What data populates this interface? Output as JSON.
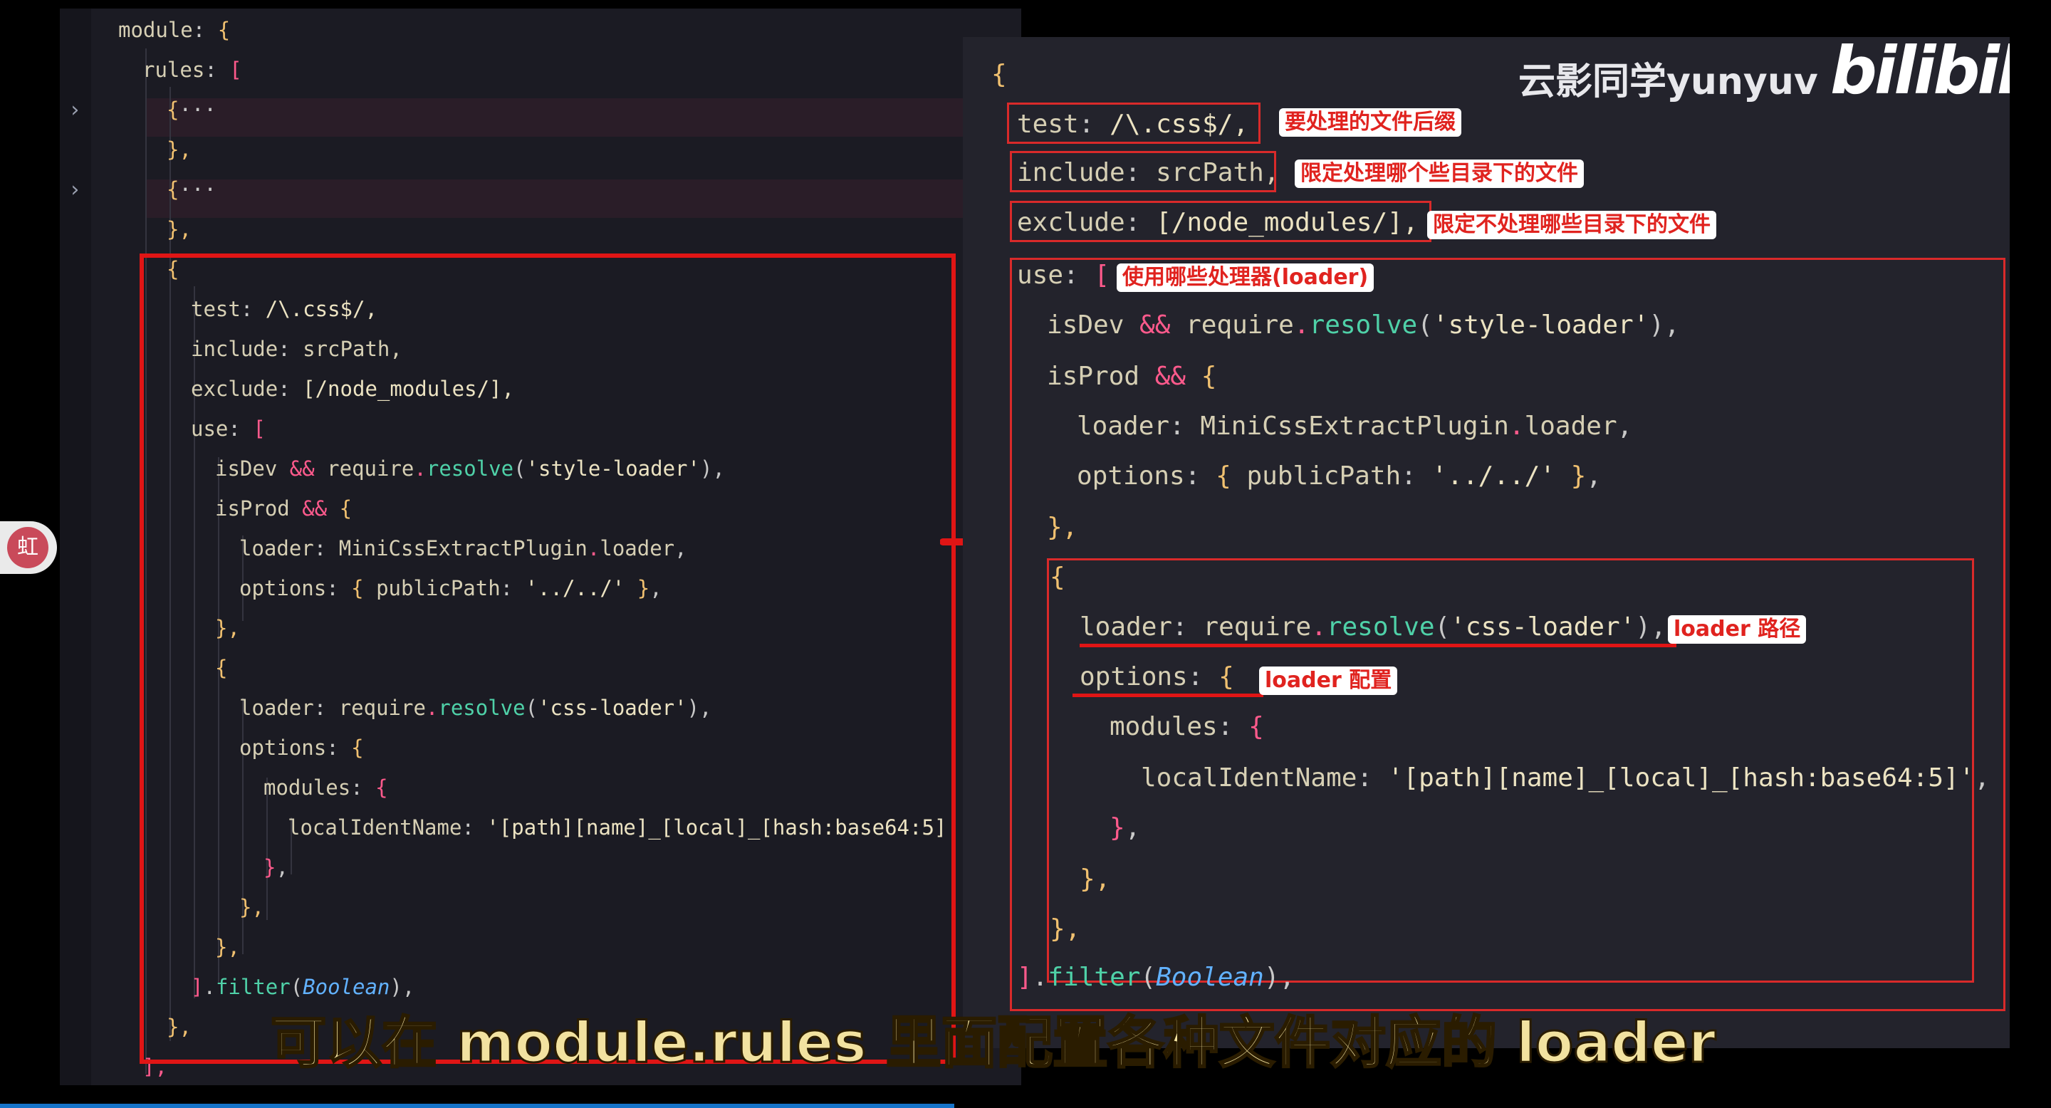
{
  "watermark": {
    "author": "云影同学yunyuv",
    "logo": "bilibili"
  },
  "avatar": {
    "label": "虹"
  },
  "subtitle": "可以在 module.rules 里面配置各种文件对应的 loader",
  "left_code": {
    "module": "module",
    "rules": "rules",
    "collapsed_brace": "{",
    "ellipsis": "···",
    "close_obj": "},",
    "open_brace": "{",
    "test_key": "test",
    "test_val": "/\\.css$/,",
    "include_key": "include",
    "include_val": "srcPath,",
    "exclude_key": "exclude",
    "exclude_val": "[/node_modules/],",
    "use_key": "use",
    "isDev": "isDev",
    "and": "&&",
    "require": "require",
    "resolve": "resolve",
    "style_loader": "'style-loader'",
    "isProd": "isProd",
    "loader_key": "loader",
    "mini_plugin": "MiniCssExtractPlugin",
    "loader_prop": "loader",
    "options_key": "options",
    "publicPath_key": "publicPath",
    "publicPath_val": "'../../'",
    "css_loader": "'css-loader'",
    "modules_key": "modules",
    "localIdentName_key": "localIdentName",
    "localIdentName_val": "'[path][name]_[local]_[hash:base64:5]'",
    "filter": "filter",
    "boolean": "Boolean",
    "close_array": "],"
  },
  "annotations": {
    "suffix": "要处理的文件后缀",
    "include_dirs": "限定处理哪个些目录下的文件",
    "exclude_dirs": "限定不处理哪些目录下的文件",
    "use_loaders": "使用哪些处理器(loader)",
    "loader_path": "loader 路径",
    "loader_config": "loader 配置"
  }
}
